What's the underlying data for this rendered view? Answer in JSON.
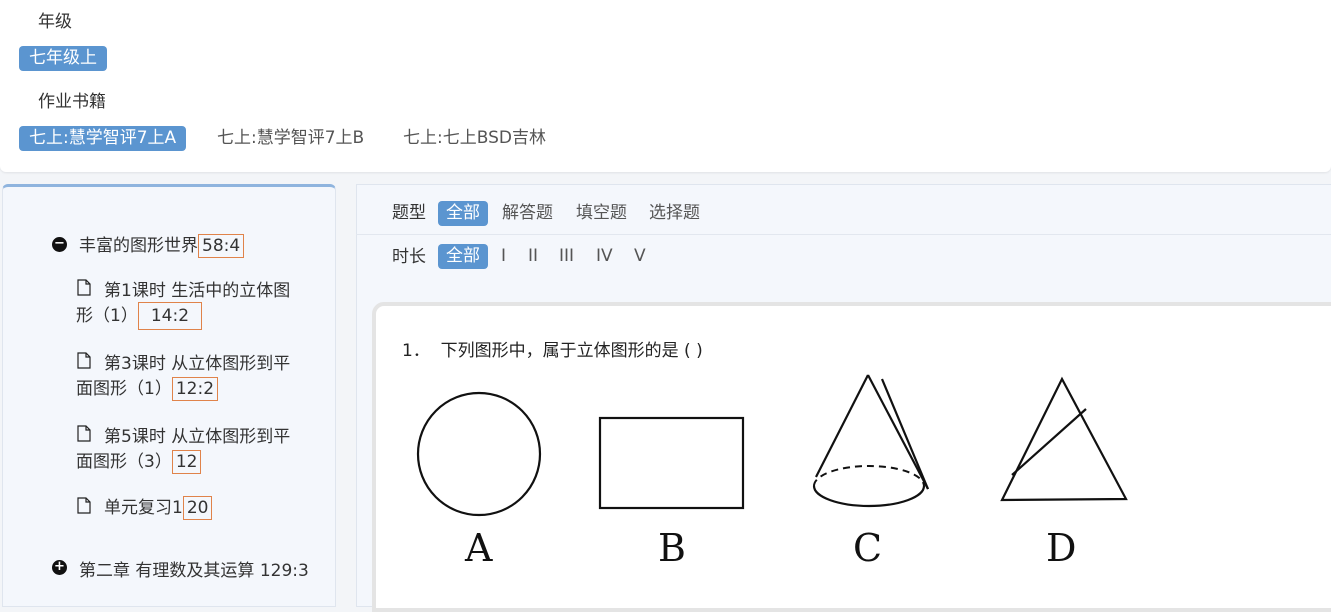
{
  "filters": {
    "grade_label": "年级",
    "grade_tags": [
      "七年级上"
    ],
    "book_label": "作业书籍",
    "book_tags": [
      "七上:慧学智评7上A",
      "七上:慧学智评7上B",
      "七上:七上BSD吉林"
    ]
  },
  "sidebar": {
    "chapter1": {
      "title": "丰富的图形世界",
      "count": "58:4"
    },
    "lessons": [
      {
        "line1": "第1课时 生活中的立体图",
        "line2": "形（1）",
        "count": "14:2"
      },
      {
        "line1": "第3课时 从立体图形到平",
        "line2": "面图形（1）",
        "count": "12:2"
      },
      {
        "line1": "第5课时 从立体图形到平",
        "line2": "面图形（3）",
        "count": "12"
      },
      {
        "line1": "单元复习1",
        "line2": "",
        "count": "20"
      }
    ],
    "chapter2": {
      "title": "第二章 有理数及其运算",
      "count": "129:3"
    }
  },
  "main": {
    "type_label": "题型",
    "type_options": [
      "全部",
      "解答题",
      "填空题",
      "选择题"
    ],
    "duration_label": "时长",
    "duration_options": [
      "全部",
      "I",
      "II",
      "III",
      "IV",
      "V"
    ],
    "question": {
      "number": "1．",
      "text": "下列图形中，属于立体图形的是 ( )",
      "options": [
        "A",
        "B",
        "C",
        "D"
      ]
    }
  }
}
